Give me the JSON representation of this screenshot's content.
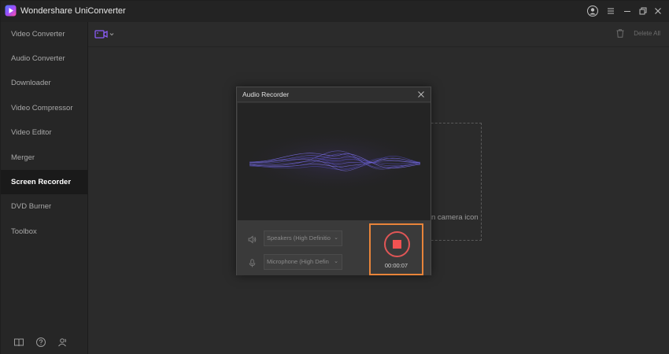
{
  "app": {
    "title": "Wondershare UniConverter",
    "accent_color": "#8a5cf5"
  },
  "window_controls": [
    "user-icon",
    "menu-icon",
    "minimize-icon",
    "restore-icon",
    "close-icon"
  ],
  "sidebar": {
    "items": [
      {
        "label": "Video Converter",
        "active": false
      },
      {
        "label": "Audio Converter",
        "active": false
      },
      {
        "label": "Downloader",
        "active": false
      },
      {
        "label": "Video Compressor",
        "active": false
      },
      {
        "label": "Video Editor",
        "active": false
      },
      {
        "label": "Merger",
        "active": false
      },
      {
        "label": "Screen Recorder",
        "active": true
      },
      {
        "label": "DVD Burner",
        "active": false
      },
      {
        "label": "Toolbox",
        "active": false
      }
    ],
    "bottom_icons": [
      "book-icon",
      "help-icon",
      "account-icon"
    ]
  },
  "toolbar": {
    "delete_all_label": "Delete All"
  },
  "main": {
    "hint_text": "n camera icon"
  },
  "dialog": {
    "title": "Audio Recorder",
    "speaker_value": "Speakers (High Definitio",
    "microphone_value": "Microphone (High Defin",
    "timer": "00:00:07",
    "highlight_color": "#e8843a",
    "record_color": "#f25252"
  }
}
